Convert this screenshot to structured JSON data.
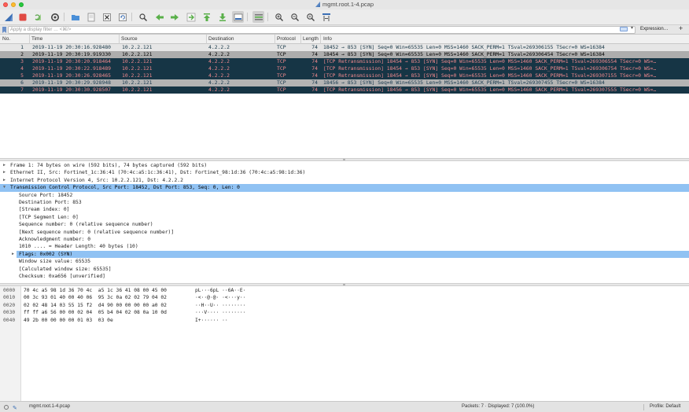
{
  "window": {
    "title": "mgmt.root.1-4.pcap"
  },
  "filter": {
    "placeholder": "Apply a display filter … <⌘/>",
    "expression_label": "Expression…",
    "add_label": "+"
  },
  "columns": {
    "no": "No.",
    "time": "Time",
    "source": "Source",
    "destination": "Destination",
    "protocol": "Protocol",
    "length": "Length",
    "info": "Info"
  },
  "packets": [
    {
      "no": "1",
      "time": "2019-11-19 20:30:16.928480",
      "src": "10.2.2.121",
      "dst": "4.2.2.2",
      "proto": "TCP",
      "len": "74",
      "info": "18452 → 853 [SYN] Seq=0 Win=65535 Len=0 MSS=1460 SACK_PERM=1 TSval=269306155 TSecr=0 WS=16384",
      "style": "plain"
    },
    {
      "no": "2",
      "time": "2019-11-19 20:30:19.919330",
      "src": "10.2.2.121",
      "dst": "4.2.2.2",
      "proto": "TCP",
      "len": "74",
      "info": "18454 → 853 [SYN] Seq=0 Win=65535 Len=0 MSS=1460 SACK_PERM=1 TSval=269306454 TSecr=0 WS=16384",
      "style": "sel"
    },
    {
      "no": "3",
      "time": "2019-11-19 20:30:20.918464",
      "src": "10.2.2.121",
      "dst": "4.2.2.2",
      "proto": "TCP",
      "len": "74",
      "info": "[TCP Retransmission] 18454 → 853 [SYN] Seq=0 Win=65535 Len=0 MSS=1460 SACK_PERM=1 TSval=269306554 TSecr=0 WS=…",
      "style": "bad"
    },
    {
      "no": "4",
      "time": "2019-11-19 20:30:22.918489",
      "src": "10.2.2.121",
      "dst": "4.2.2.2",
      "proto": "TCP",
      "len": "74",
      "info": "[TCP Retransmission] 18454 → 853 [SYN] Seq=0 Win=65535 Len=0 MSS=1460 SACK_PERM=1 TSval=269306754 TSecr=0 WS=…",
      "style": "bad"
    },
    {
      "no": "5",
      "time": "2019-11-19 20:30:26.928465",
      "src": "10.2.2.121",
      "dst": "4.2.2.2",
      "proto": "TCP",
      "len": "74",
      "info": "[TCP Retransmission] 18454 → 853 [SYN] Seq=0 Win=65535 Len=0 MSS=1460 SACK_PERM=1 TSval=269307155 TSecr=0 WS=…",
      "style": "bad"
    },
    {
      "no": "6",
      "time": "2019-11-19 20:30:29.928948",
      "src": "10.2.2.121",
      "dst": "4.2.2.2",
      "proto": "TCP",
      "len": "74",
      "info": "18456 → 853 [SYN] Seq=0 Win=65535 Len=0 MSS=1460 SACK_PERM=1 TSval=269307455 TSecr=0 WS=16384",
      "style": "selbad"
    },
    {
      "no": "7",
      "time": "2019-11-19 20:30:30.928507",
      "src": "10.2.2.121",
      "dst": "4.2.2.2",
      "proto": "TCP",
      "len": "74",
      "info": "[TCP Retransmission] 18456 → 853 [SYN] Seq=0 Win=65535 Len=0 MSS=1460 SACK_PERM=1 TSval=269307555 TSecr=0 WS=…",
      "style": "bad"
    }
  ],
  "details": [
    {
      "text": "Frame 1: 74 bytes on wire (592 bits), 74 bytes captured (592 bits)",
      "level": 0,
      "tri": "▶",
      "hl": false
    },
    {
      "text": "Ethernet II, Src: Fortinet_1c:36:41 (70:4c:a5:1c:36:41), Dst: Fortinet_98:1d:36 (70:4c:a5:98:1d:36)",
      "level": 0,
      "tri": "▶",
      "hl": false
    },
    {
      "text": "Internet Protocol Version 4, Src: 10.2.2.121, Dst: 4.2.2.2",
      "level": 0,
      "tri": "▶",
      "hl": false
    },
    {
      "text": "Transmission Control Protocol, Src Port: 18452, Dst Port: 853, Seq: 0, Len: 0",
      "level": 0,
      "tri": "▼",
      "hl": true
    },
    {
      "text": "Source Port: 18452",
      "level": 1,
      "tri": "",
      "hl": false
    },
    {
      "text": "Destination Port: 853",
      "level": 1,
      "tri": "",
      "hl": false
    },
    {
      "text": "[Stream index: 0]",
      "level": 1,
      "tri": "",
      "hl": false
    },
    {
      "text": "[TCP Segment Len: 0]",
      "level": 1,
      "tri": "",
      "hl": false
    },
    {
      "text": "Sequence number: 0    (relative sequence number)",
      "level": 1,
      "tri": "",
      "hl": false
    },
    {
      "text": "[Next sequence number: 0    (relative sequence number)]",
      "level": 1,
      "tri": "",
      "hl": false
    },
    {
      "text": "Acknowledgment number: 0",
      "level": 1,
      "tri": "",
      "hl": false
    },
    {
      "text": "1010 .... = Header Length: 40 bytes (10)",
      "level": 1,
      "tri": "",
      "hl": false
    },
    {
      "text": "Flags: 0x002 (SYN)",
      "level": 1,
      "tri": "▶",
      "hl": true
    },
    {
      "text": "Window size value: 65535",
      "level": 1,
      "tri": "",
      "hl": false
    },
    {
      "text": "[Calculated window size: 65535]",
      "level": 1,
      "tri": "",
      "hl": false
    },
    {
      "text": "Checksum: 0xa656 [unverified]",
      "level": 1,
      "tri": "",
      "hl": false
    }
  ],
  "bytes": [
    {
      "off": "0000",
      "hex": "70 4c a5 98 1d 36 70 4c  a5 1c 36 41 08 00 45 00",
      "ascii": "pL···6pL ··6A··E·"
    },
    {
      "off": "0010",
      "hex": "00 3c 93 01 40 00 40 06  95 3c 0a 02 02 79 04 02",
      "ascii": "·<··@·@· ·<···y··"
    },
    {
      "off": "0020",
      "hex": "02 02 48 14 03 55 15 f2  d4 90 00 00 00 00 a0 02",
      "ascii": "··H··U·· ········"
    },
    {
      "off": "0030",
      "hex": "ff ff a6 56 00 00 02 04  05 b4 04 02 08 0a 10 0d",
      "ascii": "···V···· ········"
    },
    {
      "off": "0040",
      "hex": "49 2b 00 00 00 00 01 03  03 0e",
      "ascii": "I+······ ··"
    }
  ],
  "status": {
    "file": "mgmt.root.1-4.pcap",
    "packets": "Packets: 7 · Displayed: 7 (100.0%)",
    "profile": "Profile: Default"
  },
  "colors": {
    "bad_row_bg": "#163545",
    "bad_row_fg": "#f0898d",
    "selection": "#90c2f3",
    "plain_row_bg": "#e6e6e6"
  }
}
